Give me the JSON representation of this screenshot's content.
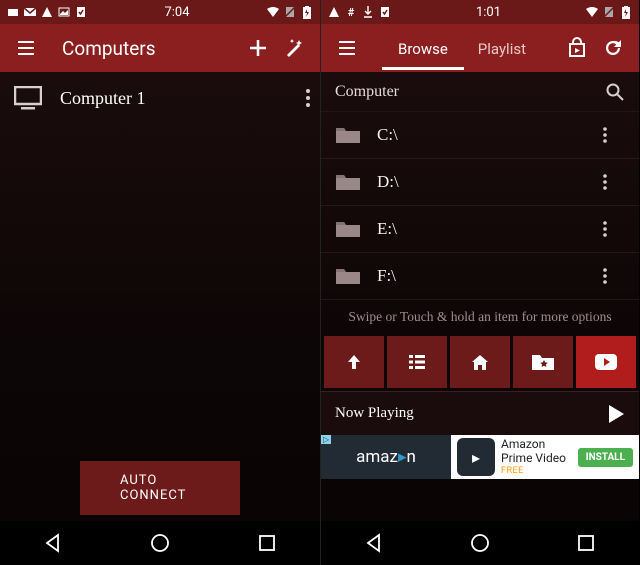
{
  "left": {
    "status": {
      "time": "7:04"
    },
    "appbar": {
      "title": "Computers"
    },
    "list": [
      {
        "label": "Computer 1"
      }
    ],
    "autoConnect": "AUTO CONNECT"
  },
  "right": {
    "status": {
      "time": "1:01"
    },
    "tabs": {
      "browse": "Browse",
      "playlist": "Playlist"
    },
    "breadcrumb": "Computer",
    "drives": [
      {
        "label": "C:\\"
      },
      {
        "label": "D:\\"
      },
      {
        "label": "E:\\"
      },
      {
        "label": "F:\\"
      }
    ],
    "hint": "Swipe or Touch & hold an item for more options",
    "nowPlaying": "Now Playing",
    "ad": {
      "brand": "amaz",
      "title": "Amazon Prime Video",
      "sub": "FREE",
      "cta": "INSTALL"
    }
  }
}
